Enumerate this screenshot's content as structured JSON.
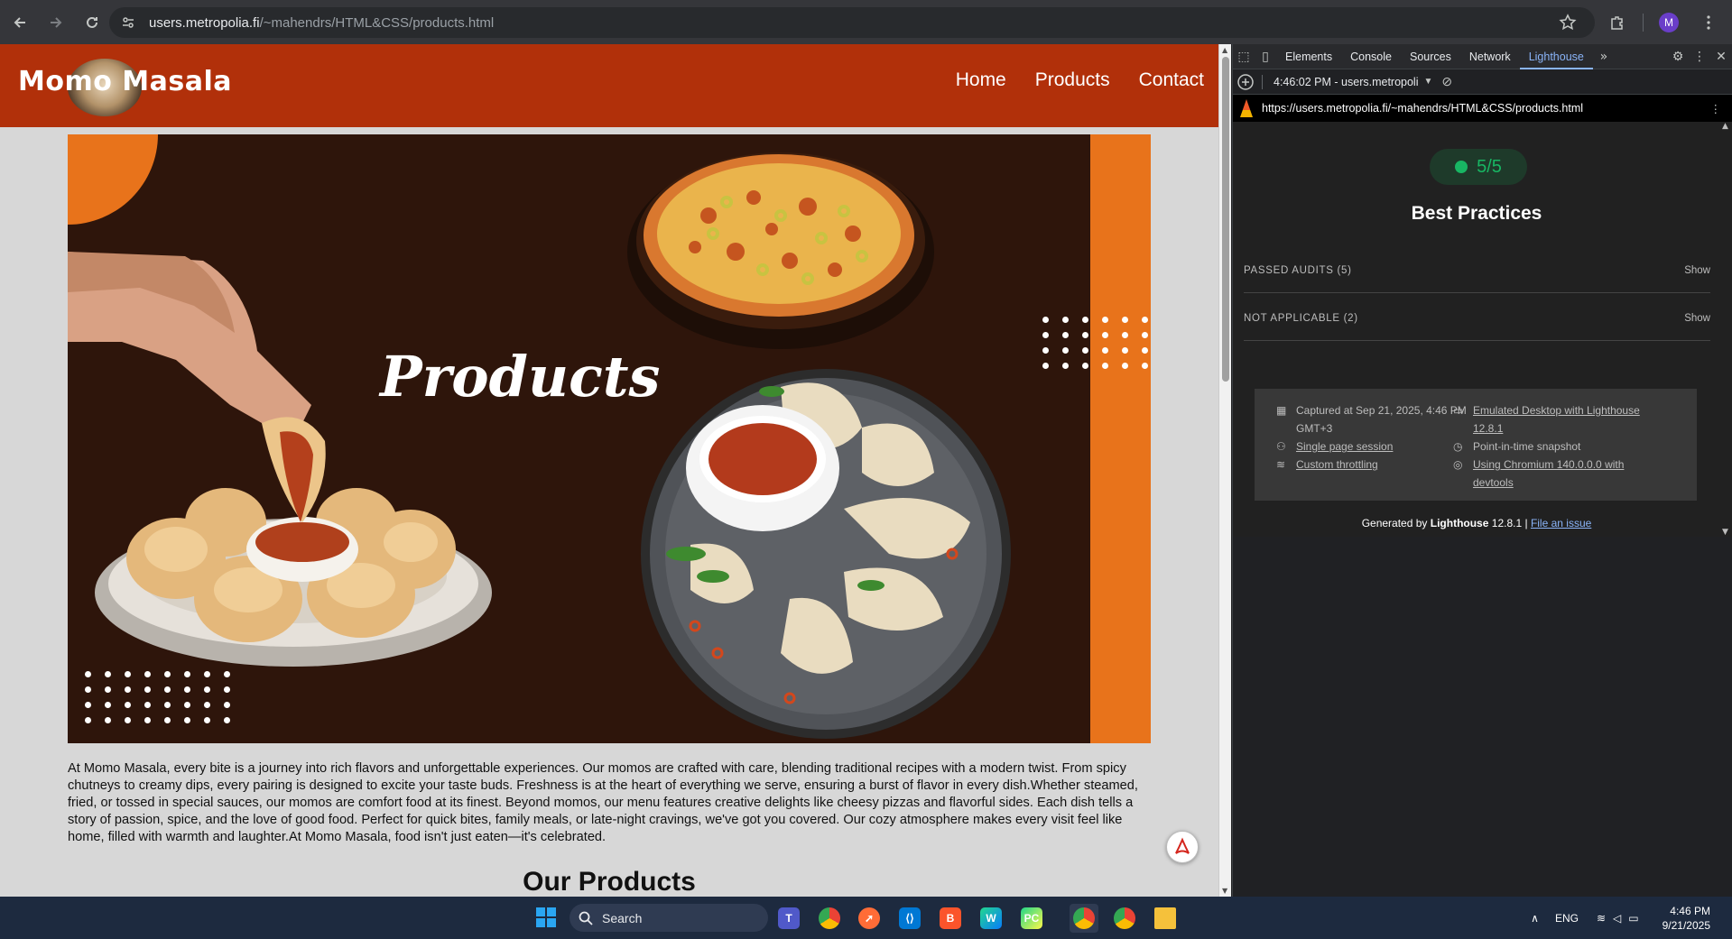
{
  "browser": {
    "url_host": "users.metropolia.fi",
    "url_path": "/~mahendrs/HTML&CSS/products.html",
    "profile_initial": "M"
  },
  "site": {
    "logo": "Momo Masala",
    "nav": [
      "Home",
      "Products",
      "Contact"
    ],
    "hero_title": "Products",
    "intro": "At Momo Masala, every bite is a journey into rich flavors and unforgettable experiences. Our momos are crafted with care, blending traditional recipes with a modern twist. From spicy chutneys to creamy dips, every pairing is designed to excite your taste buds. Freshness is at the heart of everything we serve, ensuring a burst of flavor in every dish.Whether steamed, fried, or tossed in special sauces, our momos are comfort food at its finest. Beyond momos, our menu features creative delights like cheesy pizzas and flavorful sides. Each dish tells a story of passion, spice, and the love of good food. Perfect for quick bites, family meals, or late-night cravings, we've got you covered. Our cozy atmosphere makes every visit feel like home, filled with warmth and laughter.At Momo Masala, food isn't just eaten—it's celebrated.",
    "section_title": "Our Products"
  },
  "devtools": {
    "tabs": [
      "Elements",
      "Console",
      "Sources",
      "Network",
      "Lighthouse"
    ],
    "active_tab": "Lighthouse",
    "report_select": "4:46:02 PM - users.metropoli",
    "report_url": "https://users.metropolia.fi/~mahendrs/HTML&CSS/products.html",
    "score": "5/5",
    "category_title": "Best Practices",
    "passed_audits": "PASSED AUDITS (5)",
    "not_applicable": "NOT APPLICABLE (2)",
    "show_label": "Show",
    "env": {
      "captured": "Captured at Sep 21, 2025, 4:46 PM GMT+3",
      "session": "Single page session",
      "throttling": "Custom throttling",
      "emulated": "Emulated Desktop with Lighthouse 12.8.1",
      "snapshot": "Point-in-time snapshot",
      "chromium": "Using Chromium 140.0.0.0 with devtools"
    },
    "footer_prefix": "Generated by",
    "footer_brand": "Lighthouse",
    "footer_version": "12.8.1 |",
    "footer_link": "File an issue"
  },
  "taskbar": {
    "search_label": "Search",
    "language": "ENG",
    "time": "4:46 PM",
    "date": "9/21/2025"
  },
  "colors": {
    "header": "#b1300a",
    "hero_bg": "#2e150b",
    "accent": "#e8731b",
    "score_green": "#18b663"
  }
}
